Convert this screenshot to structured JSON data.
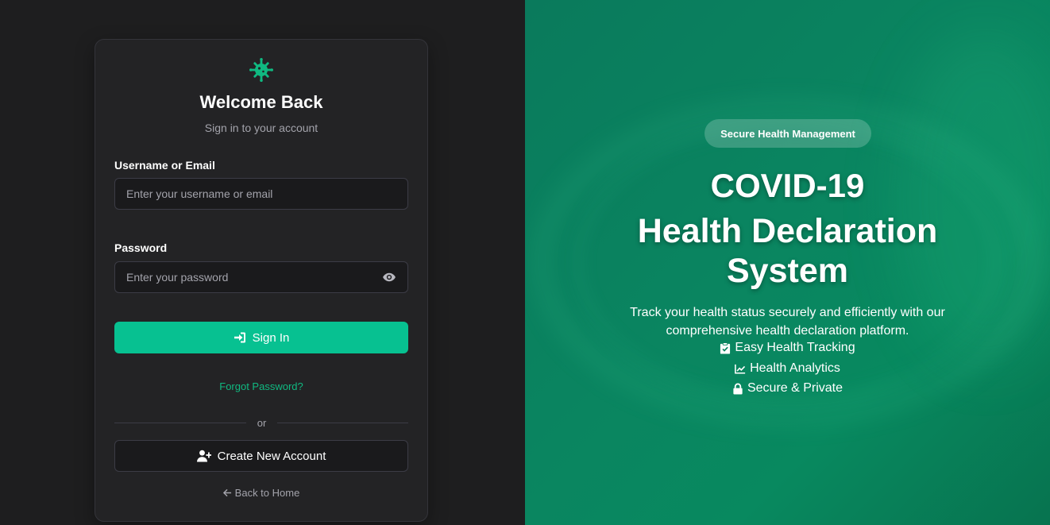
{
  "login": {
    "logo_icon": "virus-icon",
    "title": "Welcome Back",
    "subtitle": "Sign in to your account",
    "username_label": "Username or Email",
    "username_placeholder": "Enter your username or email",
    "username_value": "",
    "password_label": "Password",
    "password_placeholder": "Enter your password",
    "password_value": "",
    "password_toggle_icon": "eye-icon",
    "signin_label": "Sign In",
    "signin_icon": "sign-in-icon",
    "forgot_label": "Forgot Password?",
    "divider_text": "or",
    "create_label": "Create New Account",
    "create_icon": "user-plus-icon",
    "back_label": "Back to Home",
    "back_icon": "arrow-left-icon"
  },
  "hero": {
    "badge": "Secure Health Management",
    "title_line1": "COVID-19",
    "title_line2": "Health Declaration",
    "title_line3": "System",
    "description": "Track your health status securely and efficiently with our comprehensive health declaration platform.",
    "features": [
      {
        "icon": "clipboard-check-icon",
        "label": "Easy Health Tracking"
      },
      {
        "icon": "chart-line-icon",
        "label": "Health Analytics"
      },
      {
        "icon": "lock-icon",
        "label": "Secure & Private"
      }
    ]
  },
  "colors": {
    "accent": "#07c191",
    "link": "#10b981",
    "panel_bg": "#1e1e1f",
    "card_bg": "#232325",
    "hero_bg": "#0a8560"
  }
}
